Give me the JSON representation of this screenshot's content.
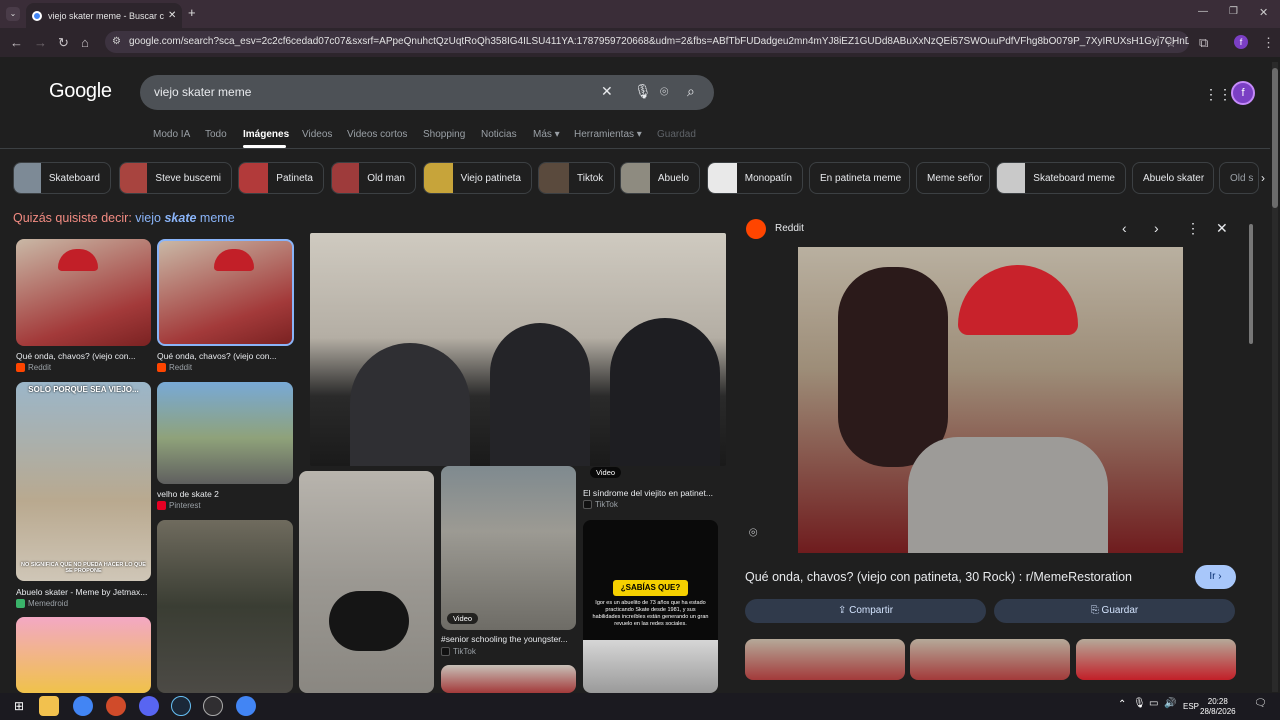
{
  "browser": {
    "tab_title": "viejo skater meme - Buscar con Google",
    "url": "google.com/search?sca_esv=2c2cf6cedad07c07&sxsrf=APpeQnuhctQzUqtRoQh358IG4ILSU411YA:1787959720668&udm=2&fbs=ABfTbFUDadgeu2mn4mYJ8iEZ1GUDd8ABuXxNzQEi57SWOuuPdfVFhg8bO079P_7XyIRUXsH1Gyj7CHnDxGGR5HAGfGV...",
    "profile_letter": "f"
  },
  "google": {
    "logo": "Google",
    "query": "viejo skater meme",
    "avatar_letter": "f",
    "tabs": [
      "Modo IA",
      "Todo",
      "Imágenes",
      "Videos",
      "Videos cortos",
      "Shopping",
      "Noticias",
      "Más ▾",
      "Herramientas ▾",
      "Guardad"
    ],
    "chips": [
      "Skateboard",
      "Steve buscemi",
      "Patineta",
      "Old man",
      "Viejo patineta",
      "Tiktok",
      "Abuelo",
      "Monopatín",
      "En patineta meme",
      "Meme señor",
      "Skateboard meme",
      "Abuelo skater",
      "Old s"
    ],
    "did_you_mean_prefix": "Quizás quisiste decir: ",
    "did_you_mean_a": "viejo ",
    "did_you_mean_b": "skate",
    "did_you_mean_c": " meme"
  },
  "results": [
    {
      "caption": "Qué onda, chavos? (viejo con...",
      "source": "Reddit"
    },
    {
      "caption": "Qué onda, chavos? (viejo con...",
      "source": "Reddit"
    },
    {
      "caption": "velho de skate 2",
      "source": "Pinterest"
    },
    {
      "caption": "Abuelo skater - Meme by Jetmax...",
      "source": "Memedroid"
    },
    {
      "caption": "El síndrome del viejito en patinet...",
      "source": "TikTok"
    },
    {
      "caption": "#senior schooling the youngster...",
      "source": "TikTok"
    }
  ],
  "video_label": "Video",
  "meme_text_top": "SOLO PORQUE SEA VIEJO...",
  "meme_text_bottom": "NO SIGNIFICA QUE NO PUEDA HACER LO QUE SE PROPONE",
  "sabias_title": "¿SABÍAS QUE?",
  "sabias_text": "Igor es un abuelito de 73 años que ha estado practicando Skate desde 1981, y sus habilidades increíbles están generando un gran revuelo en las redes sociales.",
  "panel": {
    "source": "Reddit",
    "title": "Qué onda, chavos? (viejo con patineta, 30 Rock) : r/MemeRestoration",
    "go_label": "Ir ›",
    "share_label": "Compartir",
    "save_label": "Guardar"
  },
  "taskbar": {
    "lang": "ESP",
    "time": "20:28",
    "date": "28/8/2026"
  }
}
